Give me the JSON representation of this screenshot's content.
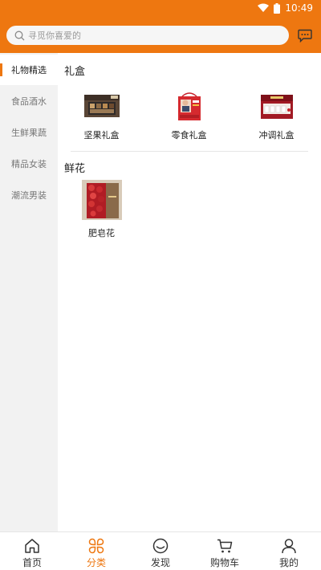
{
  "status_bar": {
    "time": "10:49",
    "icons": [
      "wifi-icon",
      "battery-icon"
    ]
  },
  "header": {
    "search_placeholder": "寻觅你喜爱的",
    "message_icon": "message-icon"
  },
  "sidebar": {
    "items": [
      {
        "label": "礼物精选",
        "active": true
      },
      {
        "label": "食品酒水",
        "active": false
      },
      {
        "label": "生鲜果蔬",
        "active": false
      },
      {
        "label": "精品女装",
        "active": false
      },
      {
        "label": "潮流男装",
        "active": false
      }
    ]
  },
  "sections": [
    {
      "title": "礼盒",
      "items": [
        {
          "label": "坚果礼盒",
          "image": "nut-gift-box-photo"
        },
        {
          "label": "零食礼盒",
          "image": "snack-gift-bag-photo"
        },
        {
          "label": "冲调礼盒",
          "image": "drink-gift-box-photo"
        }
      ]
    },
    {
      "title": "鲜花",
      "items": [
        {
          "label": "肥皂花",
          "image": "soap-flower-box-photo"
        }
      ]
    }
  ],
  "tabbar": {
    "items": [
      {
        "label": "首页",
        "icon": "home-icon",
        "active": false
      },
      {
        "label": "分类",
        "icon": "category-icon",
        "active": true
      },
      {
        "label": "发现",
        "icon": "discover-icon",
        "active": false
      },
      {
        "label": "购物车",
        "icon": "cart-icon",
        "active": false
      },
      {
        "label": "我的",
        "icon": "profile-icon",
        "active": false
      }
    ]
  },
  "colors": {
    "accent": "#ee7710",
    "sidebar_bg": "#f2f2f2"
  }
}
